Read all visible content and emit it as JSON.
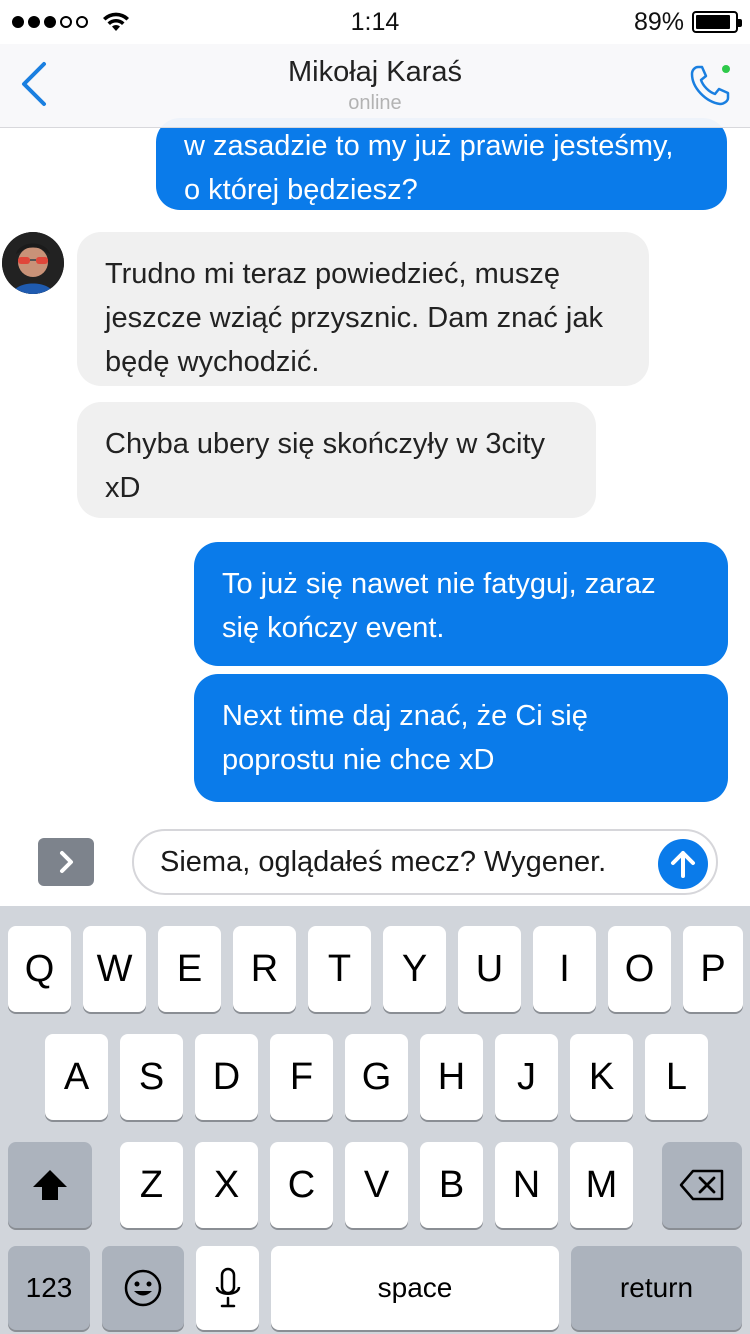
{
  "status_bar": {
    "time": "1:14",
    "battery_text": "89%",
    "battery_level": 0.89,
    "signal_bars_filled": 3,
    "signal_bars_total": 5
  },
  "header": {
    "contact_name": "Mikołaj Karaś",
    "presence": "online",
    "back_icon": "chevron-left-icon",
    "call_icon": "phone-icon",
    "accent": "#1a7fe0",
    "online_dot": "#2ec94a"
  },
  "messages": [
    {
      "from": "me",
      "lines": [
        "w zasadzie to my już prawie jesteśmy,",
        "o której będziesz?"
      ]
    },
    {
      "from": "contact",
      "lines": [
        "Trudno mi teraz powiedzieć, muszę",
        "jeszcze wziąć przysznic. Dam znać jak",
        "będę wychodzić."
      ]
    },
    {
      "from": "contact",
      "lines": [
        "Chyba ubery się skończyły w 3city",
        "xD"
      ]
    },
    {
      "from": "me",
      "lines": [
        "To już się nawet nie fatyguj, zaraz",
        "się kończy event."
      ]
    },
    {
      "from": "me",
      "lines": [
        "Next time daj znać, że Ci się",
        "poprostu nie chce xD"
      ]
    }
  ],
  "composer": {
    "text": "Siema, oglądałeś mecz? Wygener.",
    "expand_icon": "chevron-right-icon",
    "send_icon": "arrow-up-icon"
  },
  "keyboard": {
    "row1": [
      "Q",
      "W",
      "E",
      "R",
      "T",
      "Y",
      "U",
      "I",
      "O",
      "P"
    ],
    "row2": [
      "A",
      "S",
      "D",
      "F",
      "G",
      "H",
      "J",
      "K",
      "L"
    ],
    "row3": [
      "Z",
      "X",
      "C",
      "V",
      "B",
      "N",
      "M"
    ],
    "numbers_label": "123",
    "space_label": "space",
    "return_label": "return",
    "shift_icon": "shift-icon",
    "delete_icon": "backspace-icon",
    "emoji_icon": "emoji-icon",
    "mic_icon": "microphone-icon"
  },
  "colors": {
    "outgoing_bubble": "#0a7bea",
    "incoming_bubble": "#f0f0f0",
    "keyboard_bg": "#d1d5db"
  }
}
